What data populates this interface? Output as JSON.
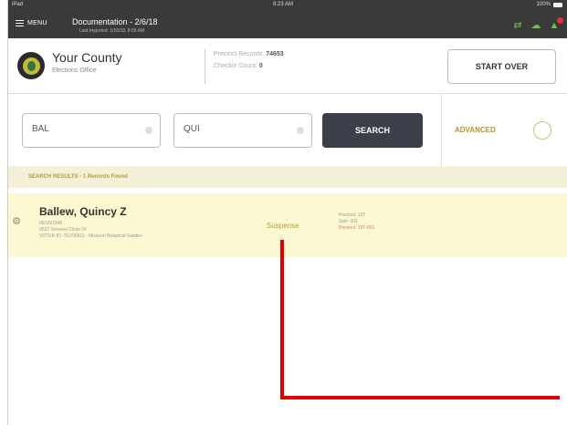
{
  "status_bar": {
    "left": "iPad",
    "time": "8:23 AM",
    "battery": "100%"
  },
  "app_bar": {
    "menu_label": "MENU",
    "title": "Documentation - 2/6/18",
    "subtitle": "Last Imported: 1/16/18, 8:55 AM"
  },
  "header": {
    "county_name": "Your County",
    "county_sub": "Elections Office",
    "precinct_label": "Precinct Records:",
    "precinct_value": "74653",
    "checkin_label": "Checkin Count:",
    "checkin_value": "0",
    "start_over": "START OVER"
  },
  "search": {
    "last_name_value": "BAL",
    "first_name_value": "QUI",
    "search_label": "SEARCH",
    "advanced_label": "ADVANCED"
  },
  "results": {
    "header": "SEARCH RESULTS - 1 Records Found",
    "items": [
      {
        "name": "Ballew, Quincy Z",
        "dob": "06/10/1948",
        "address": "9522 Veswesi Circle Dr",
        "voter_id": "VOTER ID: 7637/5811 - Missouri Botanical Garden",
        "status": "Suspense",
        "precinct": "Precinct: 197",
        "split": "Split: 001",
        "assigned": "Precinct: 197-001"
      }
    ]
  },
  "colors": {
    "accent_gold": "#b59a3a",
    "result_bg": "#fcf8d2",
    "search_button": "#3a3f4a",
    "annotation_red": "#e00000"
  }
}
